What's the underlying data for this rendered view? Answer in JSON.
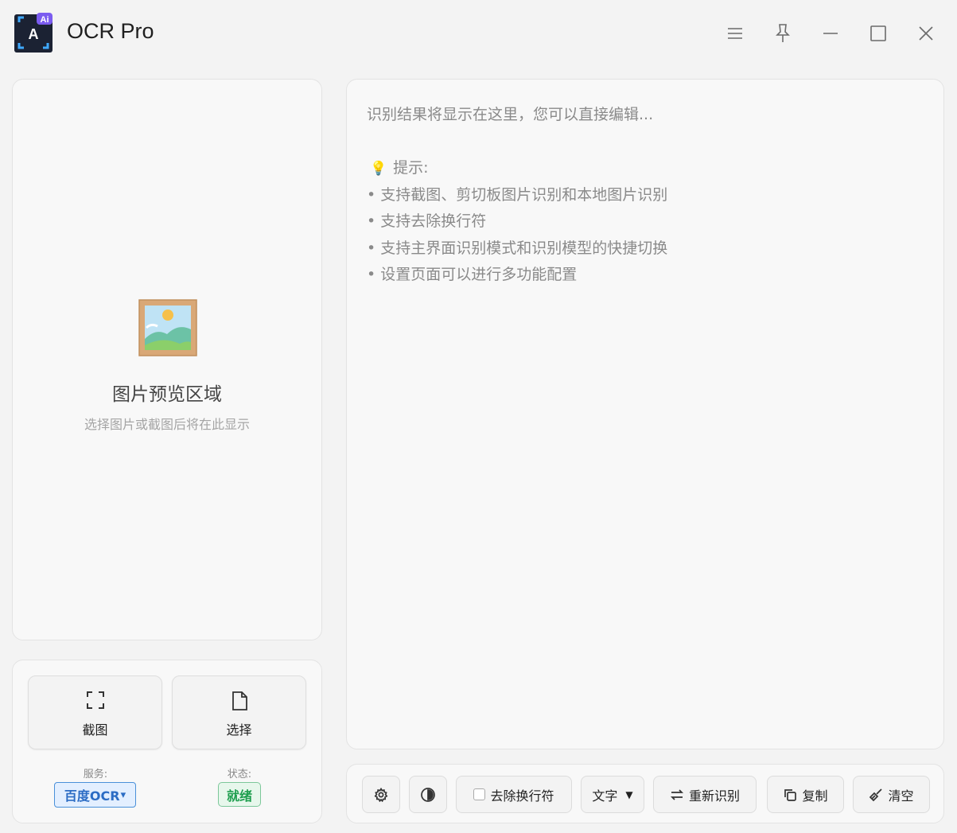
{
  "window": {
    "title": "OCR Pro",
    "logo_badge": "Ai",
    "logo_letter": "A",
    "controls": [
      "menu-icon",
      "pin-icon",
      "minimize-icon",
      "maximize-icon",
      "close-icon"
    ]
  },
  "preview": {
    "icon": "picture-icon",
    "title": "图片预览区域",
    "subtitle": "选择图片或截图后将在此显示"
  },
  "actions": {
    "screenshot_label": "截图",
    "select_label": "选择",
    "service_label": "服务:",
    "service_value": "百度OCR",
    "service_caret": "▾",
    "status_label": "状态:",
    "status_value": "就绪"
  },
  "result": {
    "placeholder_line": "识别结果将显示在这里，您可以直接编辑...",
    "tip_icon": "💡",
    "tip_title": "提示:",
    "tips": [
      "• 支持截图、剪切板图片识别和本地图片识别",
      "• 支持去除换行符",
      "• 支持主界面识别模式和识别模型的快捷切换",
      "• 设置页面可以进行多功能配置"
    ]
  },
  "toolbar": {
    "remove_newline_label": "去除换行符",
    "remove_newline_checked": false,
    "mode_value": "文字",
    "mode_caret": "▼",
    "rerecognize_label": "重新识别",
    "copy_label": "复制",
    "clear_label": "清空"
  },
  "colors": {
    "accent_blue": "#2b6cc4",
    "status_green": "#1e9e4e",
    "logo_purple": "#7b5cf0"
  }
}
